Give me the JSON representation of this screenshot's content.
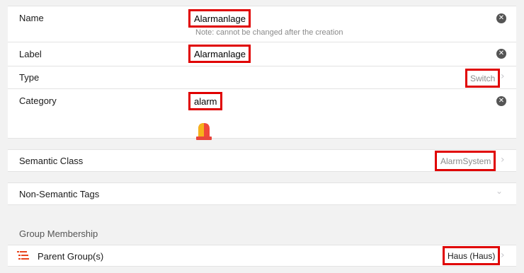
{
  "form": {
    "name": {
      "label": "Name",
      "value": "Alarmanlage",
      "note": "Note: cannot be changed after the creation"
    },
    "item_label": {
      "label": "Label",
      "value": "Alarmanlage"
    },
    "type": {
      "label": "Type",
      "value": "Switch"
    },
    "category": {
      "label": "Category",
      "value": "alarm",
      "icon": "alarm-light-icon"
    }
  },
  "semantic": {
    "label": "Semantic Class",
    "value": "AlarmSystem"
  },
  "tags": {
    "label": "Non-Semantic Tags"
  },
  "groups": {
    "section_title": "Group Membership",
    "parent": {
      "label": "Parent Group(s)",
      "value": "Haus (Haus)",
      "icon": "list-icon"
    }
  },
  "colors": {
    "highlight": "#e00000",
    "background": "#f2f2f2",
    "list_icon": "#e8451e"
  }
}
